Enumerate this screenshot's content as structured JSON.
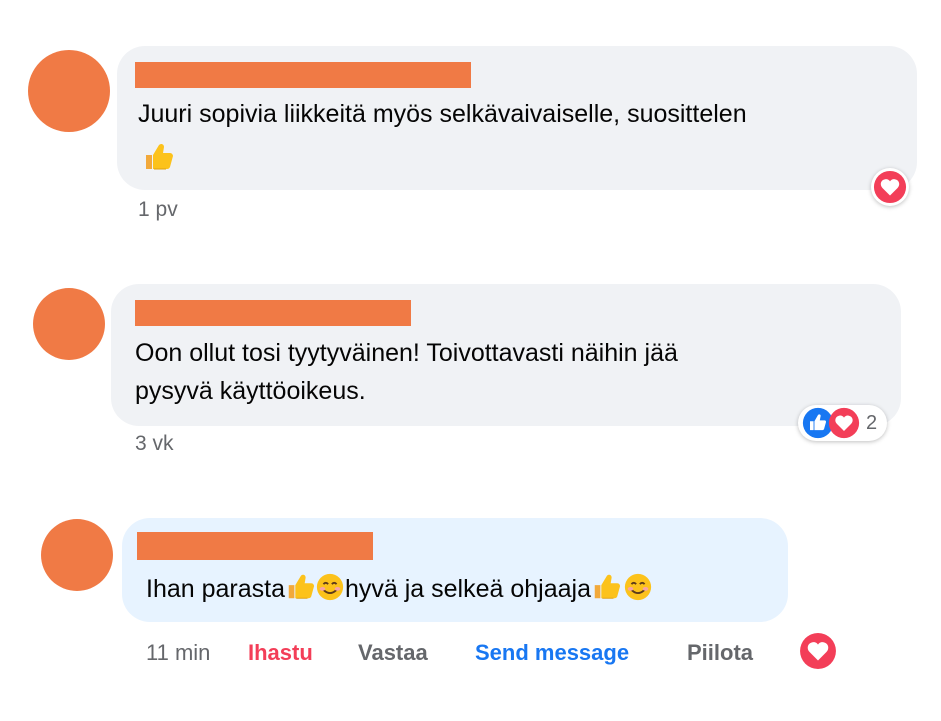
{
  "colors": {
    "redaction": "#f07a45",
    "bubble": "#f0f2f5",
    "bubble_highlight": "#e7f3ff",
    "love": "#f33e58",
    "like": "#1877f2",
    "meta": "#65676b"
  },
  "comments": [
    {
      "text": "Juuri sopivia liikkeitä myös selkävaivaiselle, suosittelen",
      "emoji": [
        "thumbs-up-icon"
      ],
      "time": "1 pv",
      "reactions": [
        "heart-icon"
      ]
    },
    {
      "text_line1": "Oon ollut tosi tyytyväinen! Toivottavasti näihin jää",
      "text_line2": "pysyvä käyttöoikeus.",
      "time": "3 vk",
      "reactions": [
        "like-icon",
        "heart-icon"
      ],
      "reaction_count": "2"
    },
    {
      "text_part1": "Ihan parasta",
      "text_part2": "hyvä ja selkeä ohjaaja",
      "emoji": [
        "thumbs-up-icon",
        "smiling-face-icon",
        "thumbs-up-icon",
        "smiling-face-icon"
      ],
      "time": "11 min",
      "actions": {
        "love": "Ihastu",
        "reply": "Vastaa",
        "send_message": "Send message",
        "hide": "Piilota"
      },
      "reactions": [
        "heart-icon"
      ]
    }
  ]
}
